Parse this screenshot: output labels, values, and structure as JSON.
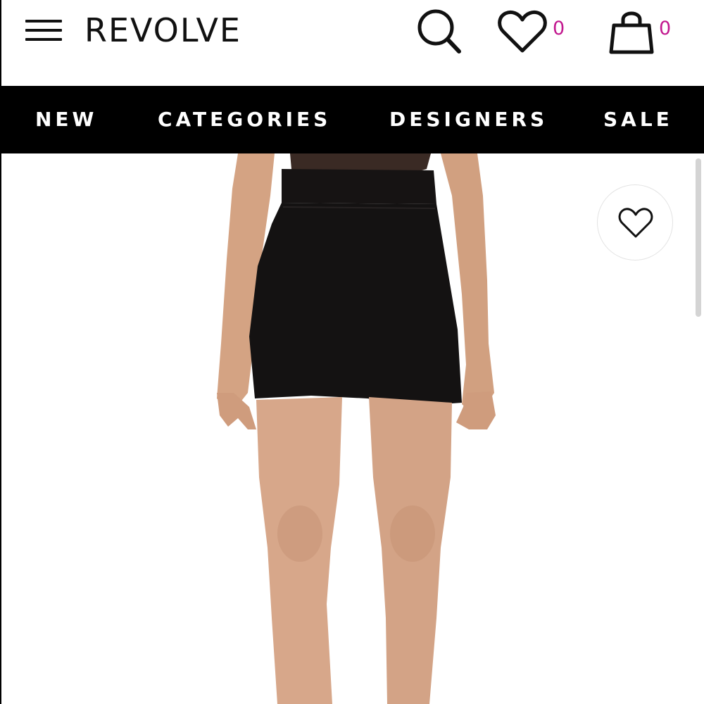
{
  "header": {
    "logo": "REVOLVE",
    "wishlist_count": "0",
    "bag_count": "0"
  },
  "icons": {
    "menu": "hamburger-menu-icon",
    "search": "search-icon",
    "wishlist": "heart-icon",
    "bag": "shopping-bag-icon",
    "favorite": "heart-outline-icon"
  },
  "nav": {
    "items": [
      {
        "label": "NEW"
      },
      {
        "label": "CATEGORIES"
      },
      {
        "label": "DESIGNERS"
      },
      {
        "label": "SALE"
      }
    ]
  },
  "colors": {
    "accent": "#c2188f",
    "nav_bg": "#000000",
    "text": "#111111",
    "background": "#ffffff",
    "skirt": "#141212",
    "lace": "#3a2a24",
    "skin": "#d4a383",
    "scrollbar": "#d4d4d4"
  }
}
